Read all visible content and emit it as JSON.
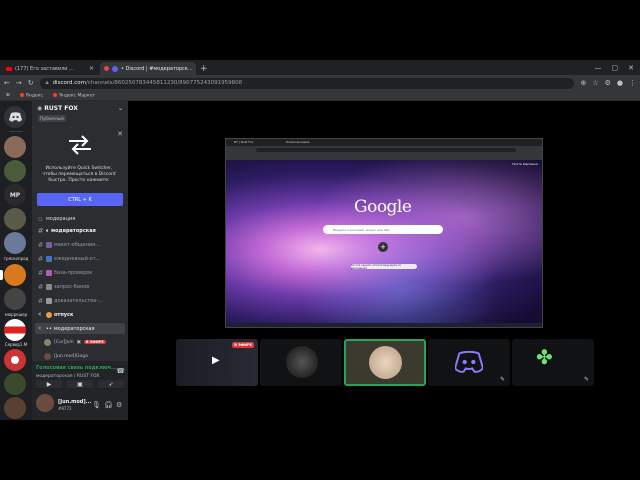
{
  "browser": {
    "tabs": [
      {
        "label": "(177) Его заставили ..."
      },
      {
        "label": "• Discord | #модераторск..."
      }
    ],
    "new_tab": "+",
    "window_controls": [
      "—",
      "▢",
      "✕"
    ],
    "address": {
      "domain": "discord.com",
      "path": "/channels/860250783445811230/890775243091959808"
    },
    "bookmarks": [
      "Яндекс",
      "Яндекс Маркет"
    ]
  },
  "servers": {
    "labels": [
      "тряскопрод",
      "мюррешер",
      "Сервер1.M"
    ]
  },
  "guild": {
    "name": "RUST FOX",
    "badge": "Публичный"
  },
  "quick_switcher": {
    "text": "Используйте Quick Switcher, чтобы перемещаться в Discord быстро. Просто нажмите:",
    "button": "CTRL + K"
  },
  "channels": [
    {
      "label": "модерация",
      "kind": "category"
    },
    {
      "label": "модераторская",
      "kind": "voice-text"
    },
    {
      "label": "макет-общения-...",
      "kind": "text"
    },
    {
      "label": "ежедневный-от...",
      "kind": "text"
    },
    {
      "label": "база-проверок",
      "kind": "text"
    },
    {
      "label": "запрос-банов",
      "kind": "text"
    },
    {
      "label": "доказательства-...",
      "kind": "text"
    },
    {
      "label": "отпуск",
      "kind": "voice"
    },
    {
      "label": "модераторская",
      "kind": "voice-selected"
    }
  ],
  "voice_users": [
    {
      "name": "[Cur]Juln",
      "live": "В ЭФИРЕ"
    },
    {
      "name": "[Jun.mod]Goga"
    }
  ],
  "voice_status": {
    "title": "Голосовая связь подключ...",
    "subtitle": "модераторская / RUST FOX"
  },
  "user_panel": {
    "name": "[Jun.mod]...",
    "tag": "#8772"
  },
  "stream": {
    "inner_tabs": [
      "RF | Rust Fox",
      "Новая вкладка"
    ],
    "google_logo": "Google",
    "search_placeholder": "Введите поисковый запрос или URL",
    "pill_text": "Хотите сделать Chrome браузером по умолчанию?",
    "corner_links": "Почта  Картинки"
  },
  "thumbnails": {
    "live": "В ЭФИРЕ"
  },
  "colors": {
    "accent": "#5865f2",
    "live": "#da373c",
    "online": "#23a55a"
  }
}
